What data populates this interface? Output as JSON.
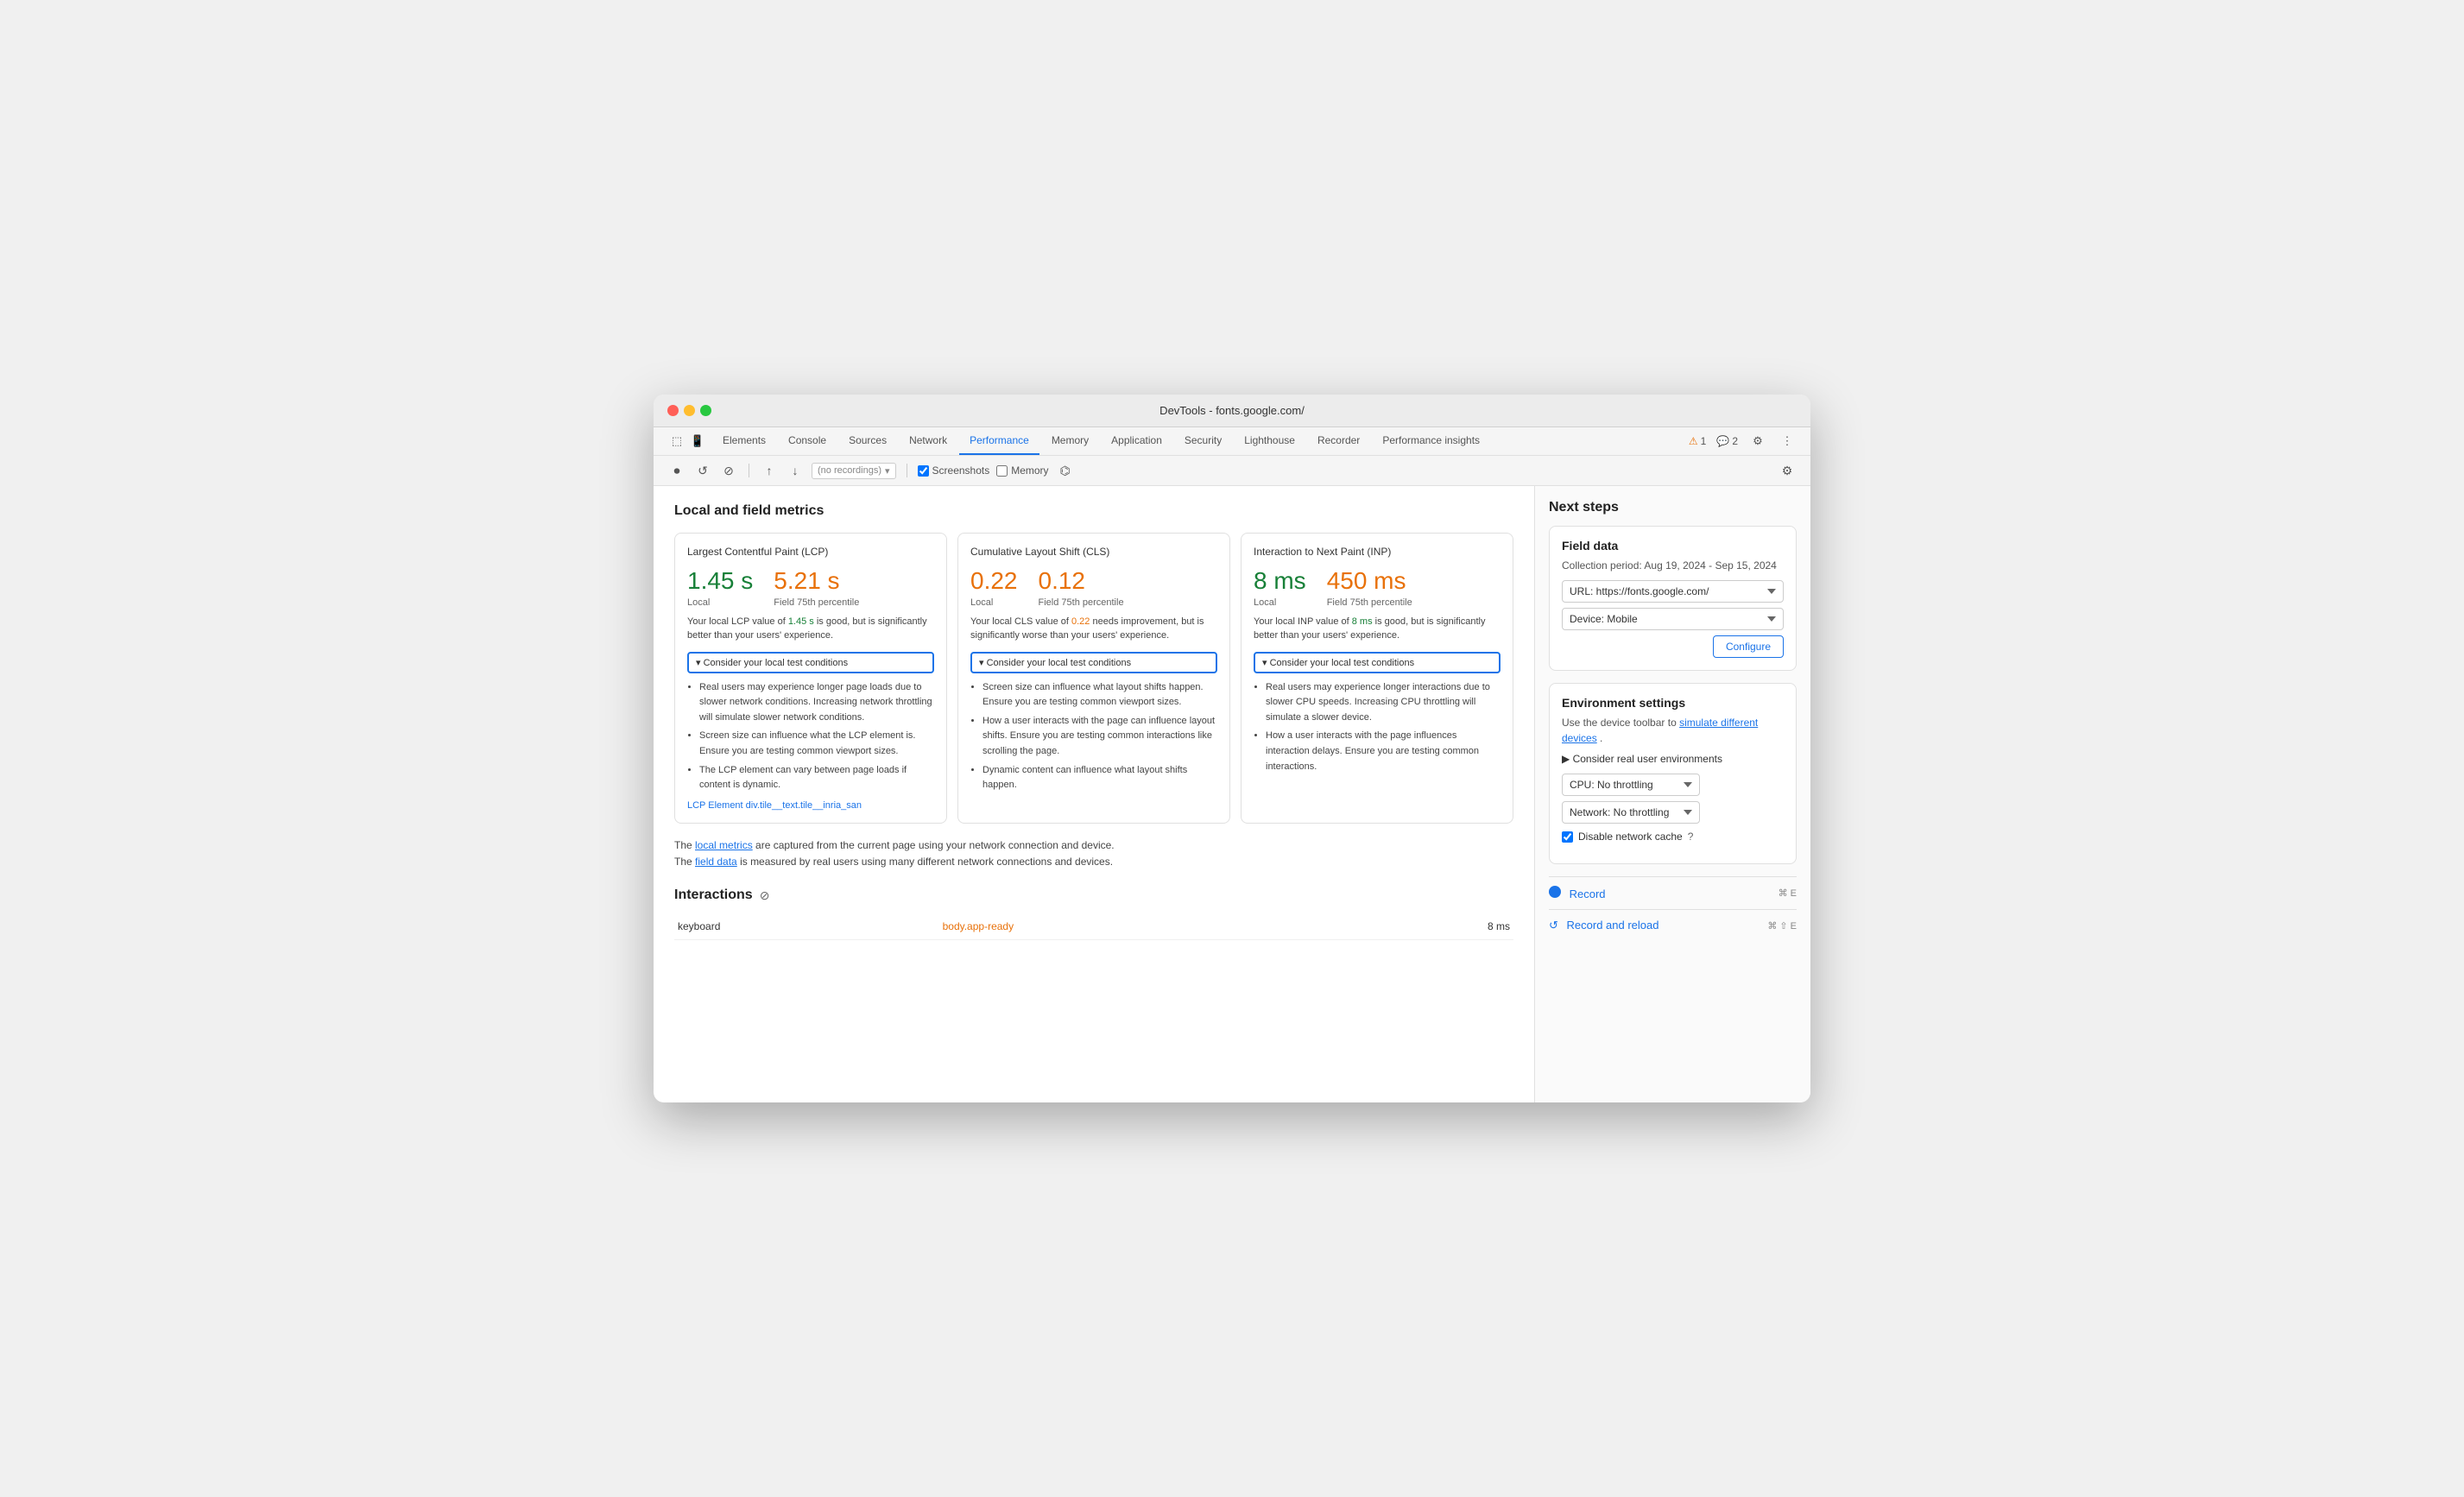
{
  "window": {
    "title": "DevTools - fonts.google.com/"
  },
  "navbar": {
    "tabs": [
      {
        "id": "elements",
        "label": "Elements",
        "active": false
      },
      {
        "id": "console",
        "label": "Console",
        "active": false
      },
      {
        "id": "sources",
        "label": "Sources",
        "active": false
      },
      {
        "id": "network",
        "label": "Network",
        "active": false
      },
      {
        "id": "performance",
        "label": "Performance",
        "active": true
      },
      {
        "id": "memory",
        "label": "Memory",
        "active": false
      },
      {
        "id": "application",
        "label": "Application",
        "active": false
      },
      {
        "id": "security",
        "label": "Security",
        "active": false
      },
      {
        "id": "lighthouse",
        "label": "Lighthouse",
        "active": false
      },
      {
        "id": "recorder",
        "label": "Recorder",
        "active": false
      },
      {
        "id": "perf-insights",
        "label": "Performance insights",
        "active": false
      }
    ],
    "right": {
      "warning_count": "1",
      "info_count": "2"
    }
  },
  "toolbar": {
    "recording_placeholder": "(no recordings)",
    "screenshots_label": "Screenshots",
    "memory_label": "Memory"
  },
  "main": {
    "section_title": "Local and field metrics",
    "metrics": [
      {
        "id": "lcp",
        "title": "Largest Contentful Paint (LCP)",
        "local_value": "1.45 s",
        "field_value": "5.21 s",
        "local_label": "Local",
        "field_label": "Field 75th percentile",
        "local_color": "good",
        "field_color": "bad",
        "description": "Your local LCP value of 1.45 s is good, but is significantly better than your users' experience.",
        "description_highlight_local": "1.45 s",
        "description_highlight_color": "good",
        "conditions_btn_label": "▾ Consider your local test conditions",
        "conditions": [
          "Real users may experience longer page loads due to slower network conditions. Increasing network throttling will simulate slower network conditions.",
          "Screen size can influence what the LCP element is. Ensure you are testing common viewport sizes.",
          "The LCP element can vary between page loads if content is dynamic."
        ],
        "lcp_element_label": "LCP Element",
        "lcp_element_value": "div.tile__text.tile__inria_san"
      },
      {
        "id": "cls",
        "title": "Cumulative Layout Shift (CLS)",
        "local_value": "0.22",
        "field_value": "0.12",
        "local_label": "Local",
        "field_label": "Field 75th percentile",
        "local_color": "bad",
        "field_color": "bad",
        "description": "Your local CLS value of 0.22 needs improvement, but is significantly worse than your users' experience.",
        "description_highlight_local": "0.22",
        "description_highlight_color": "bad",
        "conditions_btn_label": "▾ Consider your local test conditions",
        "conditions": [
          "Screen size can influence what layout shifts happen. Ensure you are testing common viewport sizes.",
          "How a user interacts with the page can influence layout shifts. Ensure you are testing common interactions like scrolling the page.",
          "Dynamic content can influence what layout shifts happen."
        ],
        "lcp_element_label": "",
        "lcp_element_value": ""
      },
      {
        "id": "inp",
        "title": "Interaction to Next Paint (INP)",
        "local_value": "8 ms",
        "field_value": "450 ms",
        "local_label": "Local",
        "field_label": "Field 75th percentile",
        "local_color": "good",
        "field_color": "bad",
        "description": "Your local INP value of 8 ms is good, but is significantly better than your users' experience.",
        "description_highlight_local": "8 ms",
        "description_highlight_color": "good",
        "conditions_btn_label": "▾ Consider your local test conditions",
        "conditions": [
          "Real users may experience longer interactions due to slower CPU speeds. Increasing CPU throttling will simulate a slower device.",
          "How a user interacts with the page influences interaction delays. Ensure you are testing common interactions."
        ],
        "lcp_element_label": "",
        "lcp_element_value": ""
      }
    ],
    "footer_notes": {
      "line1_prefix": "The ",
      "local_metrics_link": "local metrics",
      "line1_suffix": " are captured from the current page using your network connection and device.",
      "line2_prefix": "The ",
      "field_data_link": "field data",
      "line2_suffix": " is measured by real users using many different network connections and devices."
    },
    "interactions": {
      "title": "Interactions",
      "rows": [
        {
          "name": "keyboard",
          "selector": "body.app-ready",
          "time": "8 ms"
        }
      ]
    }
  },
  "right_panel": {
    "next_steps_title": "Next steps",
    "field_data": {
      "title": "Field data",
      "collection_period": "Collection period: Aug 19, 2024 - Sep 15, 2024",
      "url_label": "URL: https://fonts.google.com/",
      "device_label": "Device: Mobile",
      "configure_btn": "Configure"
    },
    "environment_settings": {
      "title": "Environment settings",
      "intro": "Use the device toolbar to",
      "simulate_link": "simulate different devices",
      "intro_end": ".",
      "consider_real_label": "▶ Consider real user environments",
      "cpu_label": "CPU: No throttling",
      "network_label": "Network: No throttling",
      "disable_cache_label": "Disable network cache",
      "record_label": "Record",
      "record_shortcut": "⌘ E",
      "record_reload_label": "Record and reload",
      "record_reload_shortcut": "⌘ ⇧ E"
    }
  },
  "icons": {
    "record": "⏺",
    "stop": "⊘",
    "reload": "↺",
    "screenshot": "📷",
    "warning": "⚠",
    "settings": "⚙",
    "more": "⋮",
    "expand": "▾",
    "chevron_down": "▾",
    "ban": "⊘"
  }
}
